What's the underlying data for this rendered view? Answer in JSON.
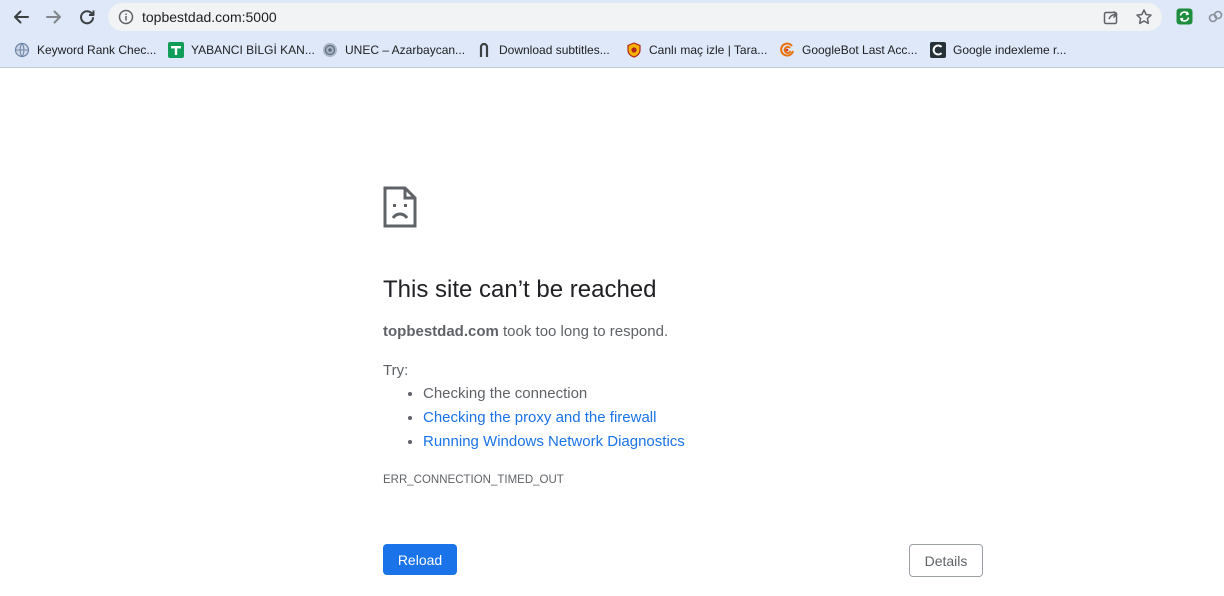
{
  "browser": {
    "url": "topbestdad.com:5000",
    "icons": {
      "back": "back-arrow-icon",
      "forward": "forward-arrow-icon",
      "reload": "reload-icon",
      "site_info": "info-icon",
      "share": "share-icon",
      "bookmark": "star-icon",
      "extension_1": "green-extension-icon",
      "extension_2": "link-extension-icon"
    }
  },
  "bookmarks": [
    {
      "label": "Keyword Rank Chec...",
      "icon": "globe-icon"
    },
    {
      "label": "YABANCI BİLGİ KAN...",
      "icon": "green-cross-icon"
    },
    {
      "label": "UNEC – Azarbaycan...",
      "icon": "seal-icon"
    },
    {
      "label": "Download subtitles...",
      "icon": "hook-icon"
    },
    {
      "label": "Canlı maç izle | Tara...",
      "icon": "shield-icon"
    },
    {
      "label": "GoogleBot Last Acc...",
      "icon": "spiral-icon"
    },
    {
      "label": "Google indexleme r...",
      "icon": "c-logo-icon"
    }
  ],
  "error_page": {
    "icon": "sad-page-icon",
    "title": "This site can’t be reached",
    "host": "topbestdad.com",
    "message": " took too long to respond.",
    "try_label": "Try:",
    "suggestions": [
      {
        "text": "Checking the connection",
        "link": false
      },
      {
        "text": "Checking the proxy and the firewall",
        "link": true
      },
      {
        "text": "Running Windows Network Diagnostics",
        "link": true
      }
    ],
    "error_code": "ERR_CONNECTION_TIMED_OUT",
    "reload_label": "Reload",
    "details_label": "Details"
  },
  "colors": {
    "toolbar_bg": "#dee8f8",
    "primary_button": "#1a73e8",
    "link": "#1a73e8",
    "body_text": "#5f6368"
  }
}
